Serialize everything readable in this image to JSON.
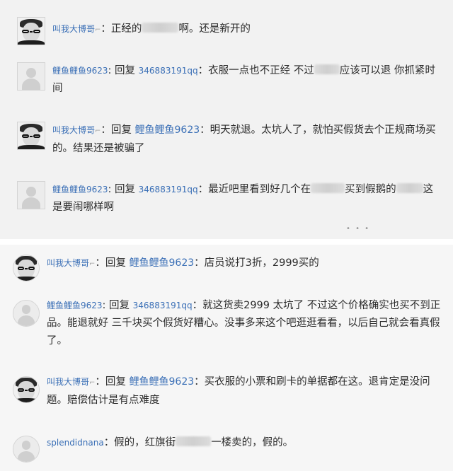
{
  "top_panel": {
    "comments": [
      {
        "user": "叫我大博哥",
        "text_before": "：正经的",
        "text_after": "啊。还是新开的"
      },
      {
        "user": "鲤鱼鲤鱼9623",
        "reply_word": "回复",
        "reply_to": "346883191qq",
        "text_before": "：衣服一点也不正经 不过",
        "text_after": "应该可以退 你抓紧时间"
      },
      {
        "user": "叫我大博哥",
        "reply_word": "回复",
        "reply_to": "鲤鱼鲤鱼9623",
        "text": "：明天就退。太坑人了，就怕买假货去个正规商场买的。结果还是被骗了"
      },
      {
        "user": "鲤鱼鲤鱼9623",
        "reply_word": "回复",
        "reply_to": "346883191qq",
        "text_before": "：最近吧里看到好几个在",
        "text_middle": "买到假鹅的",
        "text_after": "这是要闹哪样啊"
      }
    ],
    "more": "• • •"
  },
  "bottom_panel": {
    "comments": [
      {
        "user": "叫我大博哥",
        "reply_word": "回复",
        "reply_to": "鲤鱼鲤鱼9623",
        "text": "：店员说打3折，2999买的"
      },
      {
        "user": "鲤鱼鲤鱼9623",
        "reply_word": "回复",
        "reply_to": "346883191qq",
        "text": "：就这货卖2999 太坑了 不过这个价格确实也买不到正品。能退就好 三千块买个假货好糟心。没事多来这个吧逛逛看看，以后自己就会看真假了。"
      },
      {
        "user": "叫我大博哥",
        "reply_word": "回复",
        "reply_to": "鲤鱼鲤鱼9623",
        "text": "：买衣服的小票和刷卡的单据都在这。退肯定是没问题。赔偿估计是有点难度"
      },
      {
        "user": "splendidnana",
        "text_before": "：假的，红旗街",
        "text_after": "一楼卖的，假的。"
      }
    ]
  },
  "icons": {
    "vip_arrow": "⌐"
  },
  "colors": {
    "username": "#3a6fb6",
    "text": "#2b2b2b",
    "panel_top_bg": "#f2f2f2",
    "panel_bottom_bg": "#f6f6f6"
  }
}
